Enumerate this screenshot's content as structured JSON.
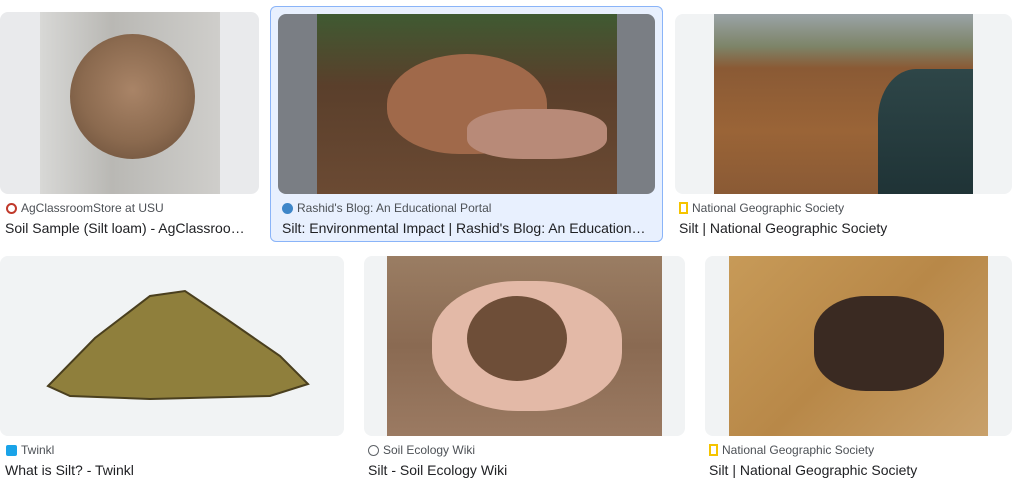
{
  "results": [
    {
      "source": "AgClassroomStore at USU",
      "title": "Soil Sample (Silt loam) - AgClassroo…",
      "favicon": "agclassroom-icon"
    },
    {
      "source": "Rashid's Blog: An Educational Portal",
      "title": "Silt: Environmental Impact | Rashid's Blog: An Education…",
      "favicon": "wordpress-icon"
    },
    {
      "source": "National Geographic Society",
      "title": "Silt | National Geographic Society",
      "favicon": "natgeo-icon"
    },
    {
      "source": "Twinkl",
      "title": "What is Silt? - Twinkl",
      "favicon": "twinkl-icon"
    },
    {
      "source": "Soil Ecology Wiki",
      "title": "Silt - Soil Ecology Wiki",
      "favicon": "globe-icon"
    },
    {
      "source": "National Geographic Society",
      "title": "Silt | National Geographic Society",
      "favicon": "natgeo-icon"
    }
  ],
  "colors": {
    "selected_bg": "#e8f0fe",
    "natgeo_yellow": "#f5c400",
    "wordpress_blue": "#3e86c8"
  }
}
